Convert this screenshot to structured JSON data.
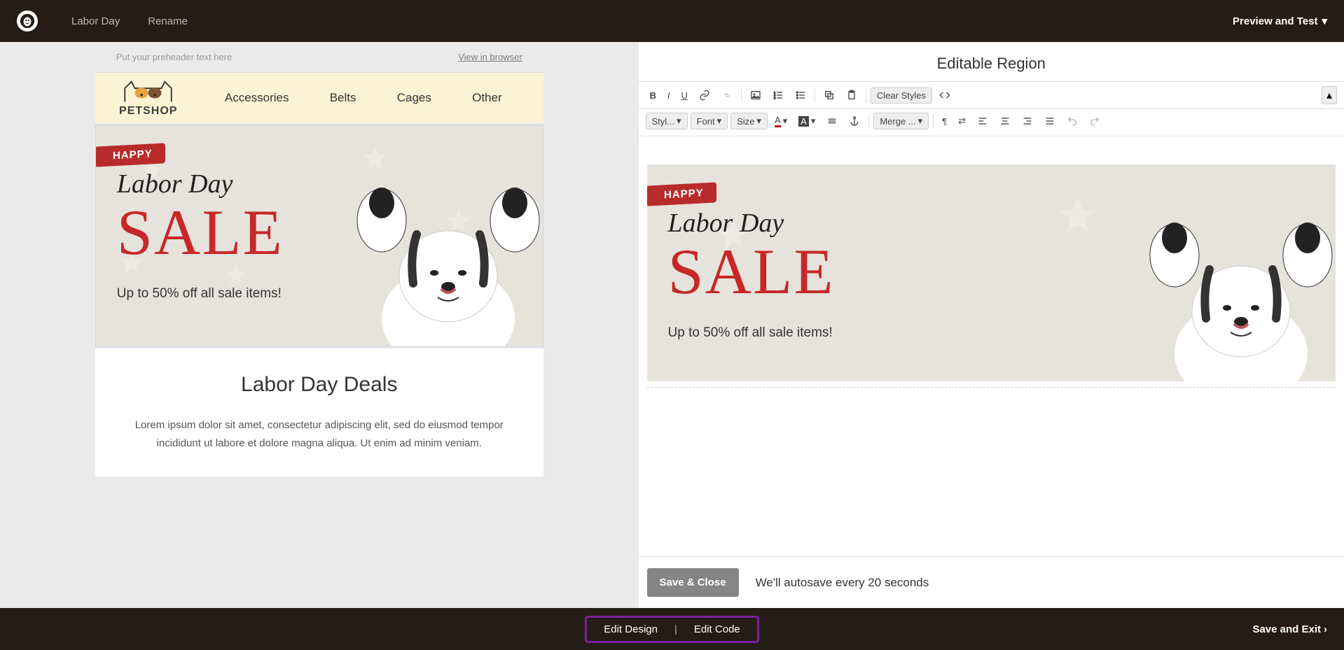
{
  "topbar": {
    "campaign_name": "Labor Day",
    "rename": "Rename",
    "preview": "Preview and Test"
  },
  "preheader": {
    "placeholder": "Put your preheader text here",
    "view_link": "View in browser"
  },
  "shop": {
    "name": "PETSHOP",
    "nav": [
      "Accessories",
      "Belts",
      "Cages",
      "Other"
    ]
  },
  "hero": {
    "badge": "HAPPY",
    "line1": "Labor Day",
    "sale": "SALE",
    "sub": "Up to 50% off all sale items!"
  },
  "deals": {
    "title": "Labor Day Deals",
    "body": "Lorem ipsum dolor sit amet, consectetur adipiscing elit, sed do eiusmod tempor incididunt ut labore et dolore magna aliqua. Ut enim ad minim veniam."
  },
  "editor": {
    "title": "Editable Region",
    "clear_styles": "Clear Styles",
    "style_drop": "Styl...",
    "font_drop": "Font",
    "size_drop": "Size",
    "merge_drop": "Merge ...",
    "save_close": "Save & Close",
    "autosave": "We'll autosave every 20 seconds"
  },
  "bottom": {
    "edit_design": "Edit Design",
    "edit_code": "Edit Code",
    "save_exit": "Save and Exit"
  }
}
